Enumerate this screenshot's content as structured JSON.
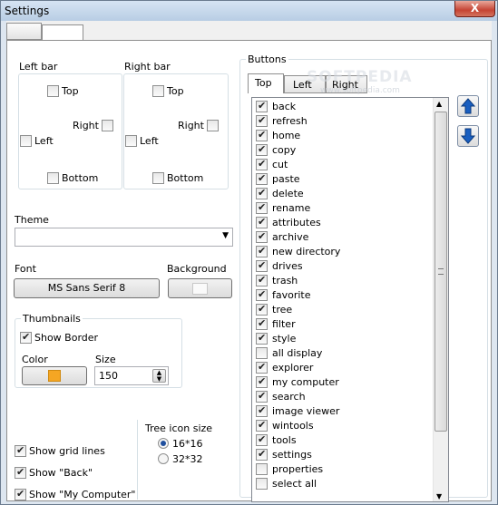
{
  "window": {
    "title": "Settings",
    "close_label": "X"
  },
  "left_bar": {
    "label": "Left bar",
    "top": "Top",
    "right": "Right",
    "left": "Left",
    "bottom": "Bottom"
  },
  "right_bar": {
    "label": "Right bar",
    "top": "Top",
    "right": "Right",
    "left": "Left",
    "bottom": "Bottom"
  },
  "theme": {
    "label": "Theme",
    "value": ""
  },
  "font": {
    "label": "Font",
    "button": "MS Sans Serif   8"
  },
  "background": {
    "label": "Background"
  },
  "thumbnails": {
    "label": "Thumbnails",
    "show_border": "Show Border",
    "color_label": "Color",
    "color": "#f5a623",
    "size_label": "Size",
    "size_value": "150"
  },
  "options": {
    "grid": "Show grid lines",
    "back": "Show \"Back\"",
    "my_computer": "Show \"My Computer\""
  },
  "tree_icon": {
    "label": "Tree icon size",
    "opt1": "16*16",
    "opt2": "32*32"
  },
  "buttons": {
    "label": "Buttons",
    "tabs": [
      "Top",
      "Left",
      "Right"
    ],
    "items": [
      {
        "label": "back",
        "checked": true
      },
      {
        "label": "refresh",
        "checked": true
      },
      {
        "label": "home",
        "checked": true
      },
      {
        "label": "copy",
        "checked": true
      },
      {
        "label": "cut",
        "checked": true
      },
      {
        "label": "paste",
        "checked": true
      },
      {
        "label": "delete",
        "checked": true
      },
      {
        "label": "rename",
        "checked": true
      },
      {
        "label": "attributes",
        "checked": true
      },
      {
        "label": "archive",
        "checked": true
      },
      {
        "label": "new directory",
        "checked": true
      },
      {
        "label": "drives",
        "checked": true
      },
      {
        "label": "trash",
        "checked": true
      },
      {
        "label": "favorite",
        "checked": true
      },
      {
        "label": "tree",
        "checked": true
      },
      {
        "label": "filter",
        "checked": true
      },
      {
        "label": "style",
        "checked": true
      },
      {
        "label": "all display",
        "checked": false
      },
      {
        "label": "explorer",
        "checked": true
      },
      {
        "label": "my computer",
        "checked": true
      },
      {
        "label": "search",
        "checked": true
      },
      {
        "label": "image viewer",
        "checked": true
      },
      {
        "label": "wintools",
        "checked": true
      },
      {
        "label": "tools",
        "checked": true
      },
      {
        "label": "settings",
        "checked": true
      },
      {
        "label": "properties",
        "checked": false
      },
      {
        "label": "select all",
        "checked": false
      }
    ]
  },
  "watermark": {
    "brand": "SOFTPEDIA",
    "url": "www.softpedia.com"
  }
}
